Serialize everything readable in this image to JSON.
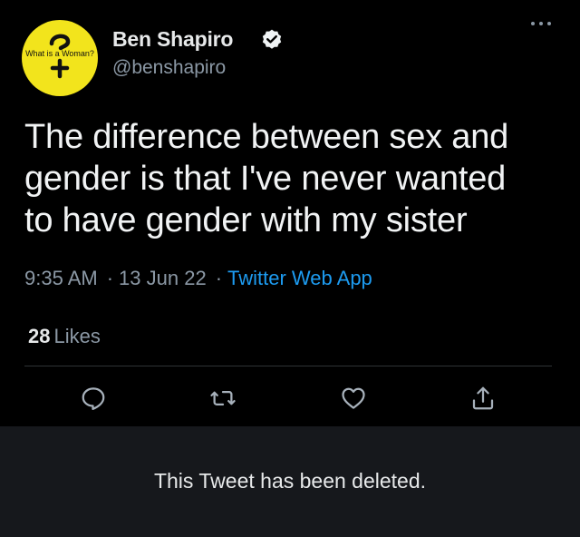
{
  "author": {
    "name": "Ben Shapiro",
    "handle": "@benshapiro",
    "avatar_text": "What is a Woman?",
    "verified_icon": "verified-badge-icon"
  },
  "tweet": {
    "lines": [
      "The difference between sex and",
      "gender is that I've never wanted",
      "to have gender with my sister"
    ],
    "time": "9:35 AM",
    "separator": "·",
    "date": "13 Jun 22",
    "source": "Twitter Web App"
  },
  "stats": {
    "likes_count": "28",
    "likes_label": "Likes"
  },
  "actions": [
    "reply-icon",
    "retweet-icon",
    "like-icon",
    "share-icon"
  ],
  "banner": {
    "text": "This Tweet has been deleted."
  },
  "colors": {
    "background": "#000000",
    "text_primary": "#e7e9ea",
    "text_secondary": "#8b98a5",
    "link": "#1d9bf0",
    "avatar_yellow": "#f2e41c",
    "banner_bg": "#16181c"
  }
}
